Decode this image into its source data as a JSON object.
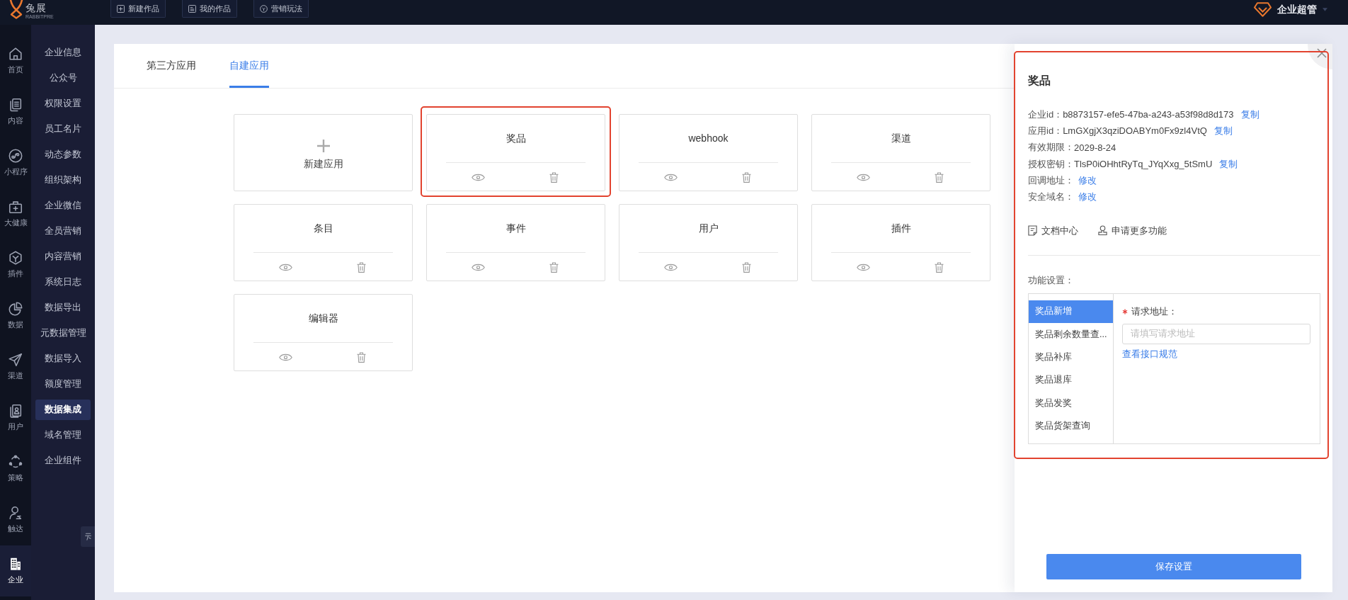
{
  "top_bar": {
    "logo": {
      "text": "兔展",
      "subtitle": "RABBITPRE"
    },
    "actions": [
      {
        "label": "新建作品"
      },
      {
        "label": "我的作品"
      },
      {
        "label": "营销玩法"
      }
    ],
    "user": {
      "name": "企业超管"
    }
  },
  "nav_rail": {
    "items": [
      {
        "label": "首页",
        "selected": false
      },
      {
        "label": "内容",
        "selected": false
      },
      {
        "label": "小程序",
        "selected": false
      },
      {
        "label": "大健康",
        "selected": false
      },
      {
        "label": "插件",
        "selected": false
      },
      {
        "label": "数据",
        "selected": false
      },
      {
        "label": "渠道",
        "selected": false
      },
      {
        "label": "用户",
        "selected": false
      },
      {
        "label": "策略",
        "selected": false
      },
      {
        "label": "触达",
        "selected": false
      },
      {
        "label": "企业",
        "selected": true
      }
    ]
  },
  "sub_nav": {
    "items": [
      {
        "label": "企业信息",
        "selected": false
      },
      {
        "label": "公众号",
        "selected": false
      },
      {
        "label": "权限设置",
        "selected": false
      },
      {
        "label": "员工名片",
        "selected": false
      },
      {
        "label": "动态参数",
        "selected": false
      },
      {
        "label": "组织架构",
        "selected": false
      },
      {
        "label": "企业微信",
        "selected": false
      },
      {
        "label": "全员营销",
        "selected": false
      },
      {
        "label": "内容营销",
        "selected": false
      },
      {
        "label": "系统日志",
        "selected": false
      },
      {
        "label": "数据导出",
        "selected": false
      },
      {
        "label": "元数据管理",
        "selected": false
      },
      {
        "label": "数据导入",
        "selected": false
      },
      {
        "label": "额度管理",
        "selected": false
      },
      {
        "label": "数据集成",
        "selected": true
      },
      {
        "label": "域名管理",
        "selected": false
      },
      {
        "label": "企业组件",
        "selected": false
      }
    ]
  },
  "tabs": [
    {
      "label": "第三方应用",
      "selected": false
    },
    {
      "label": "自建应用",
      "selected": true
    }
  ],
  "apps": [
    {
      "kind": "add",
      "label": "新建应用",
      "highlighted": false
    },
    {
      "kind": "app",
      "label": "奖品",
      "highlighted": true
    },
    {
      "kind": "app",
      "label": "webhook",
      "highlighted": false
    },
    {
      "kind": "app",
      "label": "渠道",
      "highlighted": false
    },
    {
      "kind": "app",
      "label": "条目",
      "highlighted": false
    },
    {
      "kind": "app",
      "label": "事件",
      "highlighted": false
    },
    {
      "kind": "app",
      "label": "用户",
      "highlighted": false
    },
    {
      "kind": "app",
      "label": "插件",
      "highlighted": false
    },
    {
      "kind": "app",
      "label": "编辑器",
      "highlighted": false
    }
  ],
  "detail_panel": {
    "title": "奖品",
    "highlighted": true,
    "fields": [
      {
        "label": "企业id：",
        "value": "b8873157-efe5-47ba-a243-a53f98d8d173",
        "action": "复制"
      },
      {
        "label": "应用id：",
        "value": "LmGXgjX3qziDOABYm0Fx9zl4VtQ",
        "action": "复制"
      },
      {
        "label": "有效期限：",
        "value": "2029-8-24"
      },
      {
        "label": "授权密钥：",
        "value": "TlsP0iOHhtRyTq_JYqXxg_5tSmU",
        "action": "复制"
      },
      {
        "label": "回调地址：",
        "action": "修改"
      },
      {
        "label": "安全域名：",
        "action": "修改"
      }
    ],
    "links": [
      {
        "label": "文档中心"
      },
      {
        "label": "申请更多功能"
      }
    ],
    "settings_label": "功能设置：",
    "functions": [
      {
        "label": "奖品新增",
        "selected": true
      },
      {
        "label": "奖品剩余数量查...",
        "selected": false
      },
      {
        "label": "奖品补库",
        "selected": false
      },
      {
        "label": "奖品退库",
        "selected": false
      },
      {
        "label": "奖品发奖",
        "selected": false
      },
      {
        "label": "奖品货架查询",
        "selected": false
      }
    ],
    "form": {
      "label": "请求地址：",
      "required": true,
      "placeholder": "请填写请求地址",
      "link": "查看接口规范"
    },
    "save_button": "保存设置"
  }
}
